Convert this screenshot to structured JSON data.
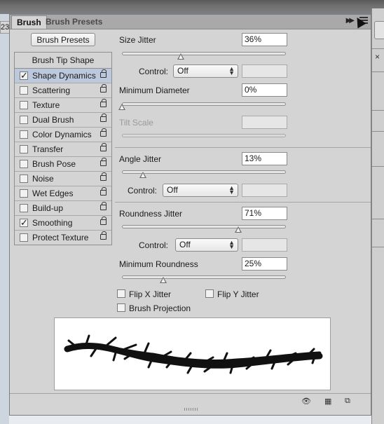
{
  "background": {
    "left_number": "23"
  },
  "panel": {
    "tabs": [
      {
        "label": "Brush",
        "active": true
      },
      {
        "label": "Brush Presets",
        "active": false
      }
    ],
    "brush_presets_button": "Brush Presets",
    "options": {
      "header": "Brush Tip Shape",
      "items": [
        {
          "label": "Shape Dynamics",
          "checked": true,
          "selected": true
        },
        {
          "label": "Scattering",
          "checked": false
        },
        {
          "label": "Texture",
          "checked": false
        },
        {
          "label": "Dual Brush",
          "checked": false
        },
        {
          "label": "Color Dynamics",
          "checked": false
        },
        {
          "label": "Transfer",
          "checked": false
        },
        {
          "label": "Brush Pose",
          "checked": false
        },
        {
          "label": "Noise",
          "checked": false
        },
        {
          "label": "Wet Edges",
          "checked": false
        },
        {
          "label": "Build-up",
          "checked": false
        },
        {
          "label": "Smoothing",
          "checked": true
        },
        {
          "label": "Protect Texture",
          "checked": false
        }
      ]
    },
    "settings": {
      "size_jitter": {
        "label": "Size Jitter",
        "value": "36%",
        "level": 36
      },
      "size_control": {
        "label": "Control:",
        "value": "Off"
      },
      "minimum_diameter": {
        "label": "Minimum Diameter",
        "value": "0%",
        "level": 0
      },
      "tilt_scale": {
        "label": "Tilt Scale",
        "value": ""
      },
      "angle_jitter": {
        "label": "Angle Jitter",
        "value": "13%",
        "level": 13
      },
      "angle_control": {
        "label": "Control:",
        "value": "Off"
      },
      "roundness_jitter": {
        "label": "Roundness Jitter",
        "value": "71%",
        "level": 71
      },
      "roundness_control": {
        "label": "Control:",
        "value": "Off"
      },
      "minimum_roundness": {
        "label": "Minimum Roundness",
        "value": "25%",
        "level": 25
      },
      "flip_x": {
        "label": "Flip X Jitter",
        "checked": false
      },
      "flip_y": {
        "label": "Flip Y Jitter",
        "checked": false
      },
      "brush_projection": {
        "label": "Brush Projection",
        "checked": false
      }
    },
    "icons": [
      "eye-brush-icon",
      "grid-icon",
      "new-preset-icon",
      "collapse-icon",
      "panel-menu-icon"
    ]
  }
}
